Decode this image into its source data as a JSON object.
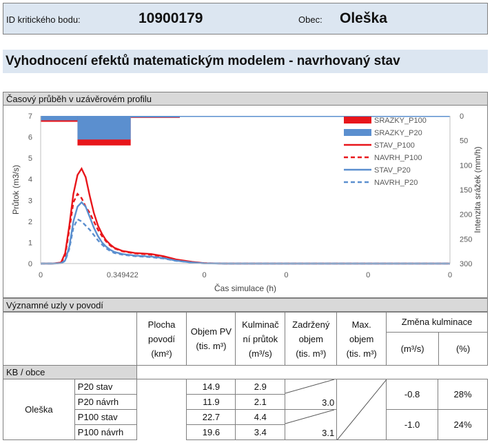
{
  "header": {
    "id_label": "ID kritického bodu:",
    "id_value": "10900179",
    "obec_label": "Obec:",
    "obec_value": "Oleška"
  },
  "title": "Vyhodnocení efektů matematickým modelem - navrhovaný stav",
  "section_chart": "Časový průběh v uzávěrovém profilu",
  "section_nodes": "Významné uzly v povodí",
  "chart_data": {
    "type": "line",
    "xlabel": "Čas simulace (h)",
    "ylabel": "Průtok (m3/s)",
    "y2label": "Intenzita srážek (mm/h)",
    "x_ticks": [
      "0",
      "0.349422",
      "0",
      "0",
      "0",
      "0"
    ],
    "y_ticks": [
      "0",
      "1",
      "2",
      "3",
      "4",
      "5",
      "6",
      "7"
    ],
    "y2_ticks": [
      "0",
      "50",
      "100",
      "150",
      "200",
      "250",
      "300"
    ],
    "ylim": [
      0,
      7
    ],
    "y2lim": [
      0,
      300
    ],
    "x": [
      0.0,
      0.03,
      0.05,
      0.06,
      0.07,
      0.08,
      0.09,
      0.1,
      0.11,
      0.12,
      0.13,
      0.14,
      0.15,
      0.16,
      0.17,
      0.18,
      0.2,
      0.23,
      0.27,
      0.3,
      0.33,
      0.37,
      0.4,
      0.45,
      1.0
    ],
    "xlim": [
      0,
      1.0
    ],
    "series": [
      {
        "name": "STAV_P100",
        "color": "#e8161b",
        "dash": false,
        "values": [
          0,
          0,
          0.05,
          0.5,
          1.8,
          3.3,
          4.2,
          4.5,
          4.1,
          3.2,
          2.4,
          1.8,
          1.4,
          1.1,
          0.9,
          0.75,
          0.6,
          0.5,
          0.45,
          0.35,
          0.2,
          0.08,
          0.02,
          0,
          0
        ]
      },
      {
        "name": "NAVRH_P100",
        "color": "#e8161b",
        "dash": true,
        "values": [
          0,
          0,
          0.04,
          0.4,
          1.6,
          2.9,
          3.3,
          3.1,
          2.7,
          2.4,
          2.0,
          1.6,
          1.3,
          1.05,
          0.85,
          0.72,
          0.58,
          0.48,
          0.42,
          0.33,
          0.18,
          0.07,
          0.02,
          0,
          0
        ]
      },
      {
        "name": "STAV_P20",
        "color": "#5b8fcf",
        "dash": false,
        "values": [
          0,
          0,
          0.02,
          0.15,
          0.8,
          2.0,
          2.7,
          2.9,
          2.7,
          2.2,
          1.7,
          1.3,
          1.0,
          0.8,
          0.65,
          0.55,
          0.45,
          0.38,
          0.33,
          0.26,
          0.14,
          0.05,
          0.01,
          0,
          0
        ]
      },
      {
        "name": "NAVRH_P20",
        "color": "#5b8fcf",
        "dash": true,
        "values": [
          0,
          0,
          0.02,
          0.12,
          0.7,
          1.7,
          2.1,
          2.0,
          1.8,
          1.6,
          1.35,
          1.1,
          0.9,
          0.72,
          0.6,
          0.5,
          0.42,
          0.35,
          0.3,
          0.24,
          0.13,
          0.05,
          0.01,
          0,
          0
        ]
      }
    ],
    "rain": [
      {
        "name": "SRAZKY_P100",
        "color": "#e8161b",
        "bars": [
          {
            "x0": 0.0,
            "x1": 0.09,
            "value": 12
          },
          {
            "x0": 0.09,
            "x1": 0.22,
            "value": 60
          },
          {
            "x0": 0.22,
            "x1": 0.34,
            "value": 4
          },
          {
            "x0": 0.34,
            "x1": 1.0,
            "value": 0
          }
        ]
      },
      {
        "name": "SRAZKY_P20",
        "color": "#5b8fcf",
        "bars": [
          {
            "x0": 0.0,
            "x1": 0.09,
            "value": 9
          },
          {
            "x0": 0.09,
            "x1": 0.22,
            "value": 48
          },
          {
            "x0": 0.22,
            "x1": 0.34,
            "value": 3
          },
          {
            "x0": 0.34,
            "x1": 1.0,
            "value": 0
          }
        ]
      }
    ],
    "legend_position": "top-right"
  },
  "table": {
    "headers": {
      "plocha": [
        "Plocha",
        "povodí",
        "(km²)"
      ],
      "objem_pv": [
        "Objem PV",
        "(tis. m³)"
      ],
      "kulminacni": [
        "Kulminač",
        "ní průtok",
        "(m³/s)"
      ],
      "zadrzeny": [
        "Zadržený",
        "objem",
        "(tis. m³)"
      ],
      "max": [
        "Max.",
        "objem",
        "(tis. m³)"
      ],
      "zmena": "Změna kulminace",
      "zmena_abs": "(m³/s)",
      "zmena_pct": "(%)"
    },
    "kb_label": "KB / obce",
    "obec": "Oleška",
    "rows": [
      {
        "label": "P20 stav",
        "objem": "14.9",
        "kulm": "2.9",
        "zadr": ""
      },
      {
        "label": "P20 návrh",
        "objem": "11.9",
        "kulm": "2.1",
        "zadr": "3.0"
      },
      {
        "label": "P100 stav",
        "objem": "22.7",
        "kulm": "4.4",
        "zadr": ""
      },
      {
        "label": "P100 návrh",
        "objem": "19.6",
        "kulm": "3.4",
        "zadr": "3.1"
      }
    ],
    "changes": [
      {
        "abs": "-0.8",
        "pct": "28%"
      },
      {
        "abs": "-1.0",
        "pct": "24%"
      }
    ]
  }
}
